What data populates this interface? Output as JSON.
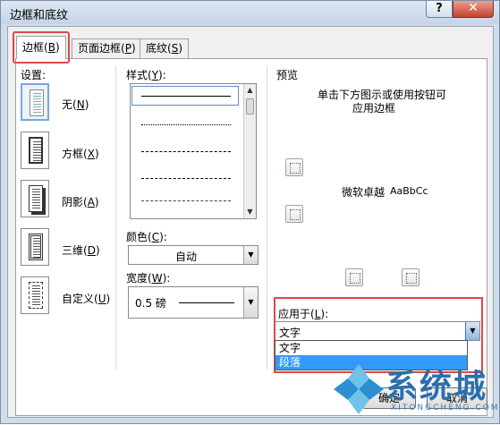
{
  "window": {
    "title": "边框和底纹",
    "help": "?",
    "close": "✕"
  },
  "tabs": [
    {
      "label": "边框",
      "key": "B"
    },
    {
      "label": "页面边框",
      "key": "P"
    },
    {
      "label": "底纹",
      "key": "S"
    }
  ],
  "settings": {
    "label": "设置:",
    "items": [
      {
        "label": "无",
        "key": "N"
      },
      {
        "label": "方框",
        "key": "X"
      },
      {
        "label": "阴影",
        "key": "A"
      },
      {
        "label": "三维",
        "key": "D"
      },
      {
        "label": "自定义",
        "key": "U"
      }
    ]
  },
  "style": {
    "label": "样式",
    "key": "Y"
  },
  "color": {
    "label": "颜色",
    "key": "C",
    "value": "自动"
  },
  "width": {
    "label": "宽度",
    "key": "W",
    "value": "0.5 磅"
  },
  "preview": {
    "label": "预览",
    "hint_line1": "单击下方图示或使用按钮可",
    "hint_line2": "应用边框",
    "sample_cn": "微软卓越",
    "sample_en": "AaBbCc"
  },
  "apply_to": {
    "label": "应用于",
    "key": "L",
    "value": "文字",
    "options": [
      "文字",
      "段落"
    ],
    "highlighted": "段落"
  },
  "buttons": {
    "ok": "确定",
    "cancel": "取消"
  },
  "watermark": {
    "text": "系统城",
    "url": "XITONGCHENG.COM"
  }
}
